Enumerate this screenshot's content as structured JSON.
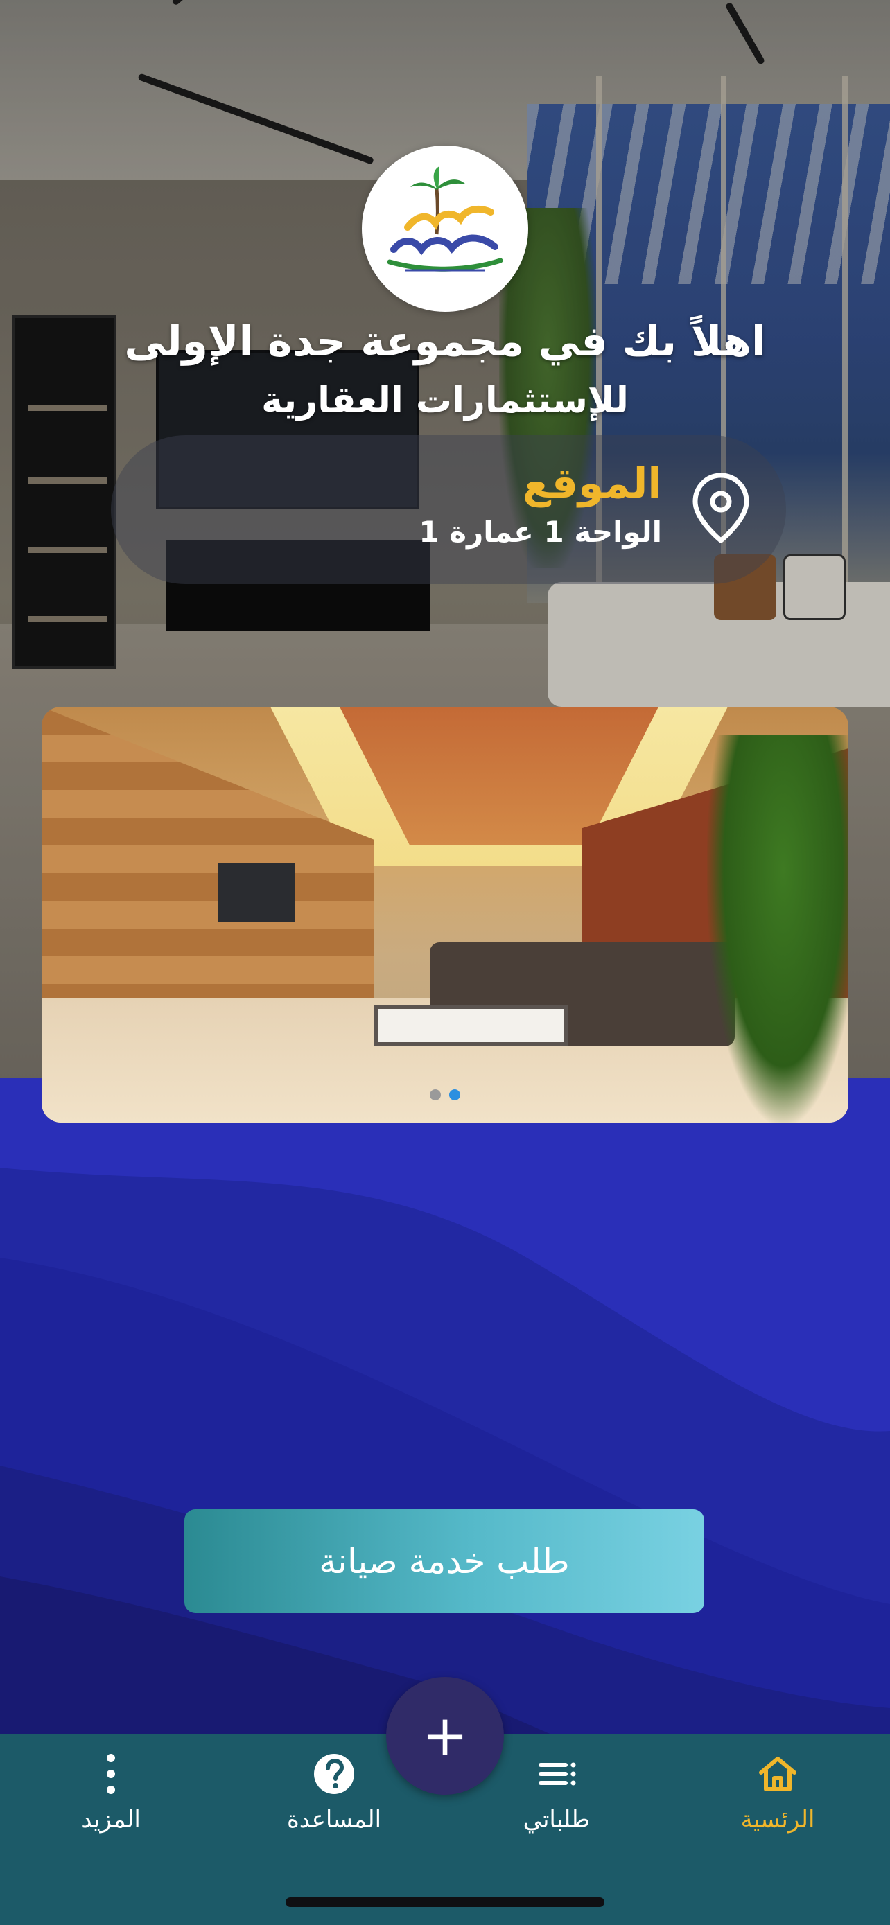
{
  "header": {
    "welcome_title": "اهلاً بك في مجموعة جدة الإولى",
    "welcome_subtitle": "للإستثمارات العقارية"
  },
  "logo": {
    "brand_text": "جدة الأولى",
    "tagline": "للإستثمارات العقارية",
    "colors": {
      "blue": "#3a4aa8",
      "gold": "#f0b62b",
      "green": "#2e8f3a"
    }
  },
  "location": {
    "label": "الموقع",
    "value": "الواحة 1 عمارة 1",
    "icon": "map-pin-icon",
    "label_color": "#f0b62b"
  },
  "carousel": {
    "slide_count": 2,
    "active_index": 1,
    "dot_colors": {
      "inactive": "#9a9a9a",
      "active": "#2b8fe0"
    }
  },
  "actions": {
    "maintenance_label": "طلب خدمة صيانة"
  },
  "fab": {
    "label": "+",
    "icon": "plus-icon"
  },
  "bottom_nav": {
    "items": [
      {
        "label": "الرئسية",
        "icon": "home-icon",
        "active": true
      },
      {
        "label": "طلباتي",
        "icon": "list-icon",
        "active": false
      },
      {
        "label": "المساعدة",
        "icon": "help-icon",
        "active": false
      },
      {
        "label": "المزيد",
        "icon": "more-vertical-icon",
        "active": false
      }
    ],
    "active_color": "#f0b62b",
    "inactive_color": "#ffffff",
    "background": "#1c5a68"
  },
  "theme": {
    "wave_colors": [
      "#2a2fb8",
      "#2228a2",
      "#1c1f88",
      "#181a70"
    ]
  }
}
